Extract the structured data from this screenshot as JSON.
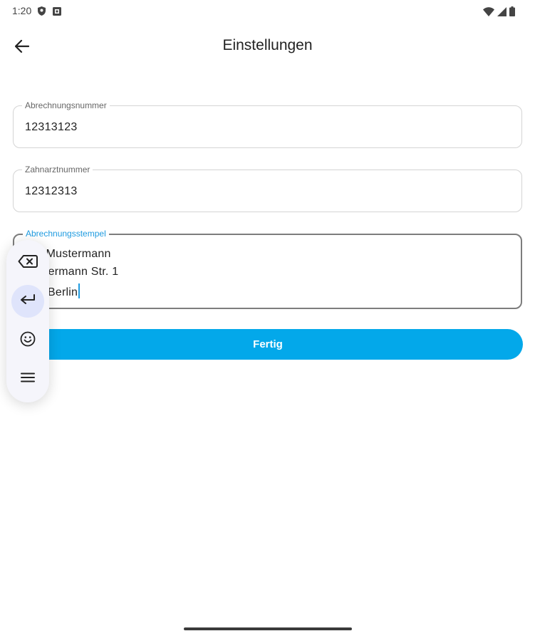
{
  "status_bar": {
    "time": "1:20",
    "left_icons": [
      "shield-icon",
      "app-notification-icon"
    ],
    "right_icons": [
      "wifi-icon",
      "cell-signal-icon",
      "battery-icon"
    ]
  },
  "top_bar": {
    "back_icon": "arrow-left-icon",
    "title": "Einstellungen"
  },
  "form": {
    "billing_number": {
      "label": "Abrechnungsnummer",
      "value": "12313123"
    },
    "dentist_number": {
      "label": "Zahnarztnummer",
      "value": "12312313"
    },
    "billing_stamp": {
      "label": "Abrechnungsstempel",
      "lines": [
        " Mustermann",
        "termann Str. 1",
        "Berlin"
      ]
    },
    "done_label": "Fertig"
  },
  "keyboard_toolbar": {
    "items": [
      "backspace-icon",
      "enter-icon",
      "emoji-icon",
      "menu-icon"
    ],
    "active_item": "enter-icon"
  },
  "colors": {
    "accent": "#03a8ea",
    "focus_label": "#1e9be0",
    "toolbar_bg": "#f5f5fb",
    "toolbar_active": "#dfe4fb"
  }
}
